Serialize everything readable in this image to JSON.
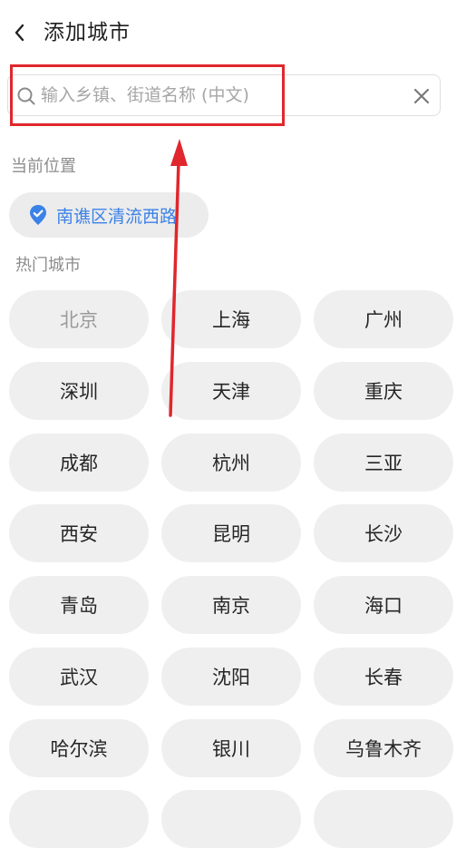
{
  "header": {
    "back_icon": "chevron-left-icon",
    "title": "添加城市"
  },
  "search": {
    "placeholder": "输入乡镇、街道名称 (中文)",
    "value": "",
    "icon": "search-icon",
    "clear_icon": "close-icon"
  },
  "current_location": {
    "label": "当前位置",
    "icon": "location-pin-icon",
    "value": "南谯区清流西路",
    "accent_color": "#3b82e8"
  },
  "hot_cities": {
    "label": "热门城市",
    "items": [
      "北京",
      "上海",
      "广州",
      "深圳",
      "天津",
      "重庆",
      "成都",
      "杭州",
      "三亚",
      "西安",
      "昆明",
      "长沙",
      "青岛",
      "南京",
      "海口",
      "武汉",
      "沈阳",
      "长春",
      "哈尔滨",
      "银川",
      "乌鲁木齐"
    ],
    "selected": "北京"
  },
  "annotation": {
    "highlight_color": "#e0272d",
    "arrow_color": "#e0272d"
  }
}
